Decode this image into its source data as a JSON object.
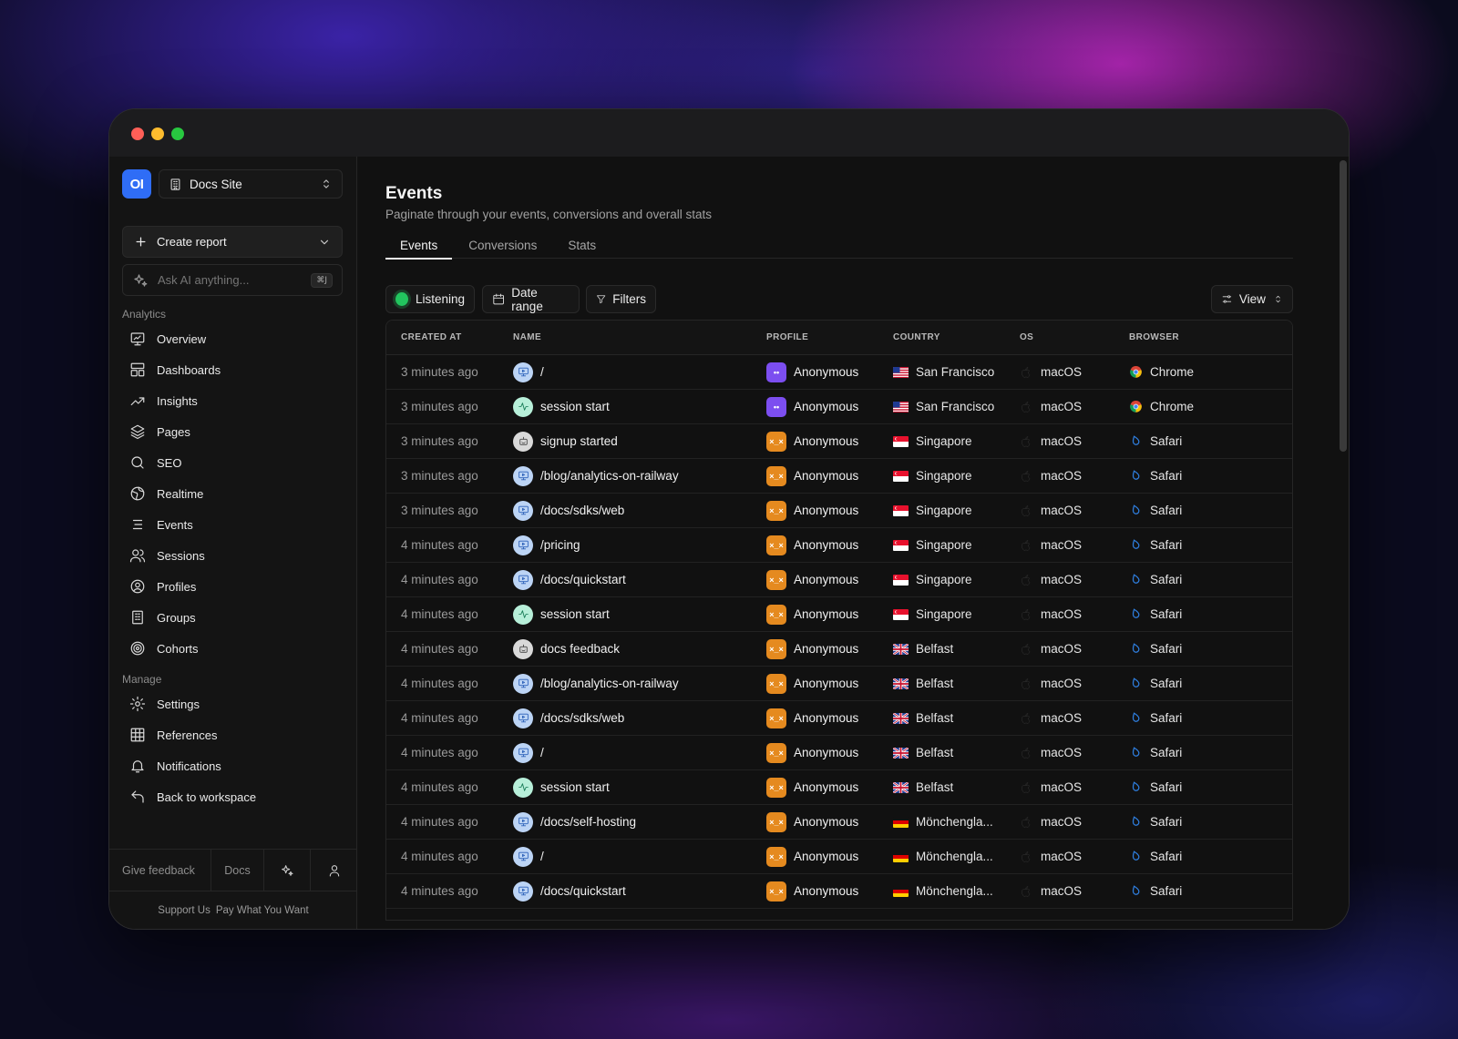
{
  "sidebar": {
    "logo_text": "OI",
    "site_select": {
      "label": "Docs Site",
      "icon": "building-icon"
    },
    "create_report": {
      "label": "Create report"
    },
    "ask_ai": {
      "placeholder": "Ask AI anything...",
      "shortcut": "⌘J"
    },
    "analytics_label": "Analytics",
    "analytics_items": [
      {
        "label": "Overview",
        "icon": "monitor-icon"
      },
      {
        "label": "Dashboards",
        "icon": "layout-icon"
      },
      {
        "label": "Insights",
        "icon": "trend-icon"
      },
      {
        "label": "Pages",
        "icon": "layers-icon"
      },
      {
        "label": "SEO",
        "icon": "search-icon"
      },
      {
        "label": "Realtime",
        "icon": "globe-icon"
      },
      {
        "label": "Events",
        "icon": "list-icon"
      },
      {
        "label": "Sessions",
        "icon": "users-icon"
      },
      {
        "label": "Profiles",
        "icon": "user-circle-icon"
      },
      {
        "label": "Groups",
        "icon": "building-icon"
      },
      {
        "label": "Cohorts",
        "icon": "target-icon"
      }
    ],
    "manage_label": "Manage",
    "manage_items": [
      {
        "label": "Settings",
        "icon": "gear-icon"
      },
      {
        "label": "References",
        "icon": "grid-icon"
      },
      {
        "label": "Notifications",
        "icon": "bell-icon"
      },
      {
        "label": "Back to workspace",
        "icon": "undo-icon"
      }
    ],
    "footer": {
      "feedback": "Give feedback",
      "docs": "Docs"
    },
    "support": {
      "left": "Support Us",
      "right": "Pay What You Want"
    }
  },
  "main": {
    "title": "Events",
    "subtitle": "Paginate through your events, conversions and overall stats",
    "tabs": [
      {
        "label": "Events",
        "active": true
      },
      {
        "label": "Conversions",
        "active": false
      },
      {
        "label": "Stats",
        "active": false
      }
    ],
    "toolbar": {
      "listening": "Listening",
      "date_range": "Date range",
      "filters": "Filters",
      "view": "View"
    },
    "table": {
      "headers": [
        "CREATED AT",
        "NAME",
        "PROFILE",
        "COUNTRY",
        "OS",
        "BROWSER"
      ],
      "rows": [
        {
          "created": "3 minutes ago",
          "name": "/",
          "type": "screen",
          "profile": "Anonymous",
          "avatar": "purple",
          "flag": "us",
          "city": "San Francisco",
          "os": "macOS",
          "browser": "Chrome"
        },
        {
          "created": "3 minutes ago",
          "name": "session start",
          "type": "session",
          "profile": "Anonymous",
          "avatar": "purple",
          "flag": "us",
          "city": "San Francisco",
          "os": "macOS",
          "browser": "Chrome"
        },
        {
          "created": "3 minutes ago",
          "name": "signup started",
          "type": "custom",
          "profile": "Anonymous",
          "avatar": "orange",
          "flag": "sg",
          "city": "Singapore",
          "os": "macOS",
          "browser": "Safari"
        },
        {
          "created": "3 minutes ago",
          "name": "/blog/analytics-on-railway",
          "type": "screen",
          "profile": "Anonymous",
          "avatar": "orange",
          "flag": "sg",
          "city": "Singapore",
          "os": "macOS",
          "browser": "Safari"
        },
        {
          "created": "3 minutes ago",
          "name": "/docs/sdks/web",
          "type": "screen",
          "profile": "Anonymous",
          "avatar": "orange",
          "flag": "sg",
          "city": "Singapore",
          "os": "macOS",
          "browser": "Safari"
        },
        {
          "created": "4 minutes ago",
          "name": "/pricing",
          "type": "screen",
          "profile": "Anonymous",
          "avatar": "orange",
          "flag": "sg",
          "city": "Singapore",
          "os": "macOS",
          "browser": "Safari"
        },
        {
          "created": "4 minutes ago",
          "name": "/docs/quickstart",
          "type": "screen",
          "profile": "Anonymous",
          "avatar": "orange",
          "flag": "sg",
          "city": "Singapore",
          "os": "macOS",
          "browser": "Safari"
        },
        {
          "created": "4 minutes ago",
          "name": "session start",
          "type": "session",
          "profile": "Anonymous",
          "avatar": "orange",
          "flag": "sg",
          "city": "Singapore",
          "os": "macOS",
          "browser": "Safari"
        },
        {
          "created": "4 minutes ago",
          "name": "docs feedback",
          "type": "custom",
          "profile": "Anonymous",
          "avatar": "orange",
          "flag": "gb",
          "city": "Belfast",
          "os": "macOS",
          "browser": "Safari"
        },
        {
          "created": "4 minutes ago",
          "name": "/blog/analytics-on-railway",
          "type": "screen",
          "profile": "Anonymous",
          "avatar": "orange",
          "flag": "gb",
          "city": "Belfast",
          "os": "macOS",
          "browser": "Safari"
        },
        {
          "created": "4 minutes ago",
          "name": "/docs/sdks/web",
          "type": "screen",
          "profile": "Anonymous",
          "avatar": "orange",
          "flag": "gb",
          "city": "Belfast",
          "os": "macOS",
          "browser": "Safari"
        },
        {
          "created": "4 minutes ago",
          "name": "/",
          "type": "screen",
          "profile": "Anonymous",
          "avatar": "orange",
          "flag": "gb",
          "city": "Belfast",
          "os": "macOS",
          "browser": "Safari"
        },
        {
          "created": "4 minutes ago",
          "name": "session start",
          "type": "session",
          "profile": "Anonymous",
          "avatar": "orange",
          "flag": "gb",
          "city": "Belfast",
          "os": "macOS",
          "browser": "Safari"
        },
        {
          "created": "4 minutes ago",
          "name": "/docs/self-hosting",
          "type": "screen",
          "profile": "Anonymous",
          "avatar": "orange",
          "flag": "de",
          "city": "Mönchengla...",
          "os": "macOS",
          "browser": "Safari"
        },
        {
          "created": "4 minutes ago",
          "name": "/",
          "type": "screen",
          "profile": "Anonymous",
          "avatar": "orange",
          "flag": "de",
          "city": "Mönchengla...",
          "os": "macOS",
          "browser": "Safari"
        },
        {
          "created": "4 minutes ago",
          "name": "/docs/quickstart",
          "type": "screen",
          "profile": "Anonymous",
          "avatar": "orange",
          "flag": "de",
          "city": "Mönchengla...",
          "os": "macOS",
          "browser": "Safari"
        }
      ]
    }
  },
  "colors": {
    "accent_blue": "#2f6df6",
    "live_green": "#22c55e",
    "avatar_purple": "#7c4ef0",
    "avatar_orange": "#e58a1f"
  }
}
